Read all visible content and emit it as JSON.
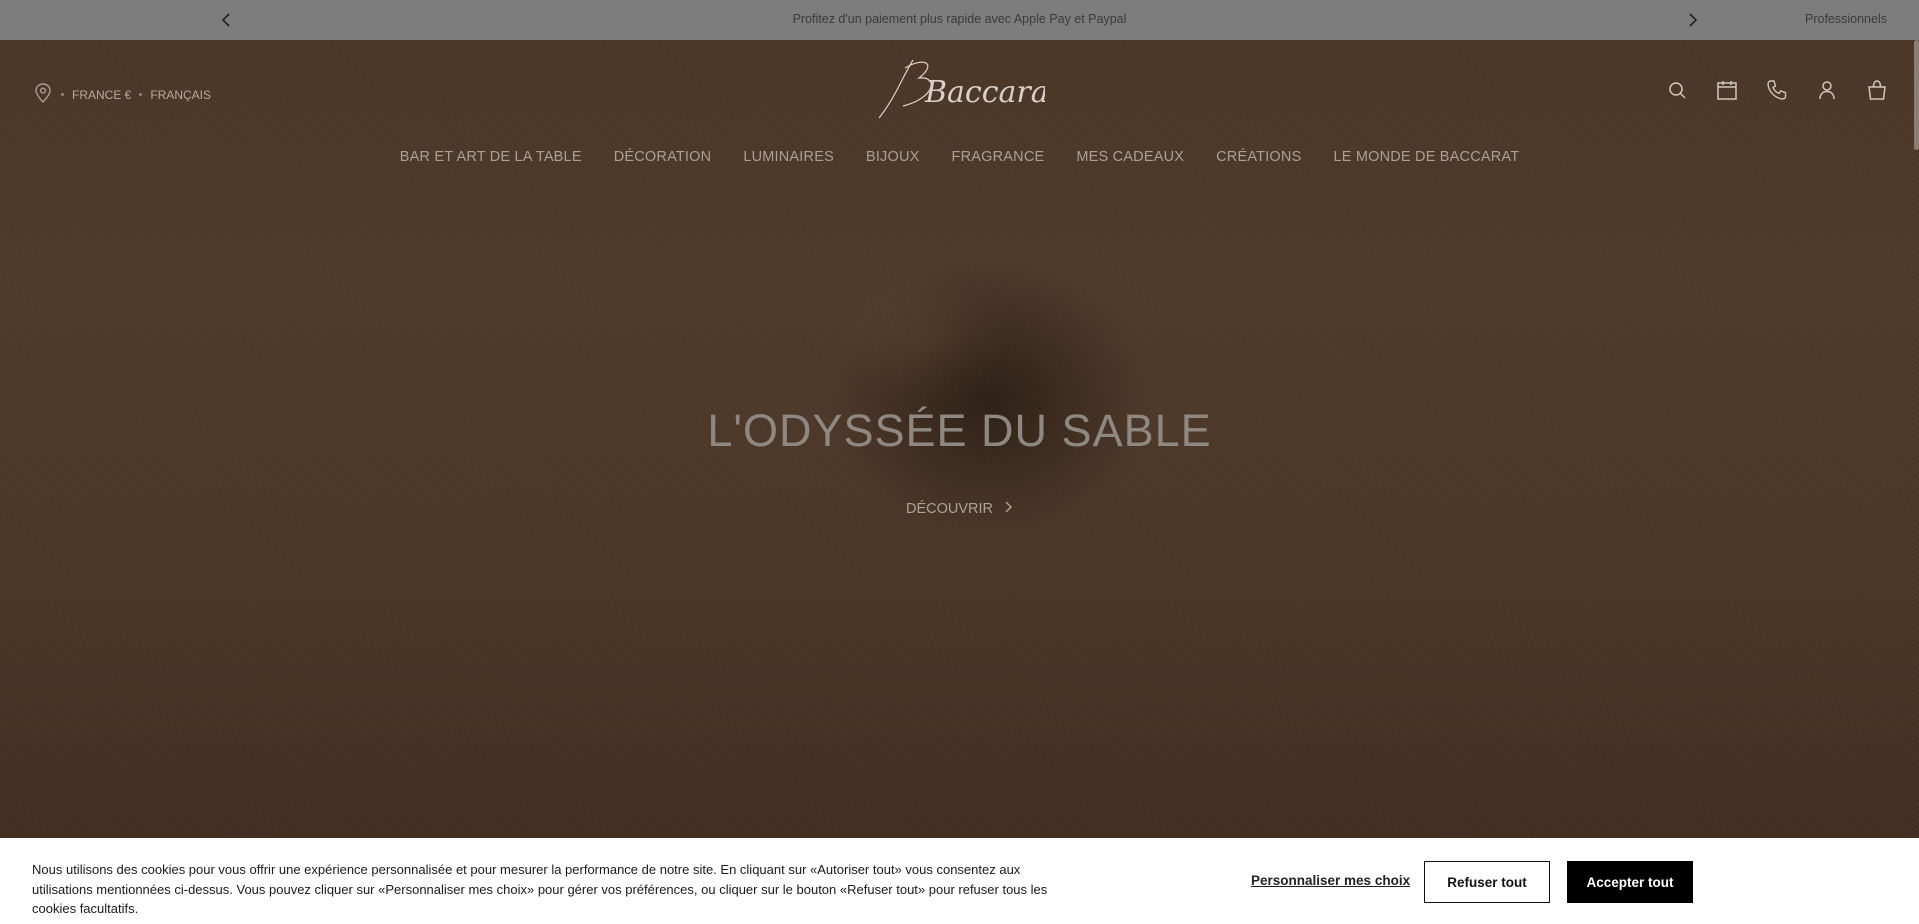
{
  "promo": {
    "message": "Profitez d'un paiement plus rapide avec Apple Pay et Paypal",
    "professional_link": "Professionnels"
  },
  "header": {
    "country": "FRANCE €",
    "language": "FRANÇAIS",
    "logo_text": "Baccarat",
    "icons": [
      "search-icon",
      "calendar-icon",
      "phone-icon",
      "account-icon",
      "bag-icon"
    ]
  },
  "nav": {
    "items": [
      "BAR ET ART DE LA TABLE",
      "DÉCORATION",
      "LUMINAIRES",
      "BIJOUX",
      "FRAGRANCE",
      "MES CADEAUX",
      "CRÉATIONS",
      "LE MONDE DE BACCARAT"
    ]
  },
  "hero": {
    "title": "L'ODYSSÉE DU SABLE",
    "cta": "DÉCOUVRIR"
  },
  "cookie": {
    "text": "Nous utilisons des cookies pour vous offrir une expérience personnalisée et pour mesurer la performance de notre site. En cliquant sur «Autoriser tout» vous consentez aux utilisations mentionnées ci-dessus. Vous pouvez cliquer sur «Personnaliser mes choix» pour gérer vos préférences, ou cliquer sur le bouton «Refuser tout» pour refuser tous les cookies facultatifs.",
    "customize": "Personnaliser mes choix",
    "refuse": "Refuser tout",
    "accept": "Accepter tout"
  },
  "colors": {
    "promo_bg": "#7d7d7d",
    "hero_bg": "#4a3526",
    "accept_bg": "#000000"
  }
}
